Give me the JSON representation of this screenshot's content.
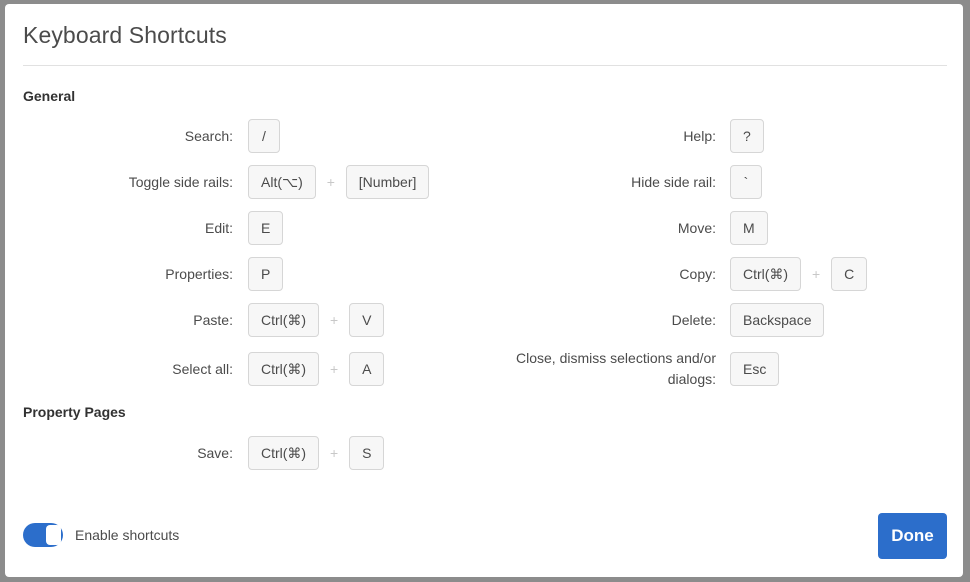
{
  "dialog": {
    "title": "Keyboard Shortcuts",
    "done_label": "Done",
    "toggle_label": "Enable shortcuts",
    "toggle_on": true
  },
  "sections": {
    "general": "General",
    "property_pages": "Property Pages"
  },
  "plus": "+",
  "left": [
    {
      "label": "Search:",
      "keys": [
        "/"
      ]
    },
    {
      "label": "Toggle side rails:",
      "keys": [
        "Alt(⌥)",
        "[Number]"
      ]
    },
    {
      "label": "Edit:",
      "keys": [
        "E"
      ]
    },
    {
      "label": "Properties:",
      "keys": [
        "P"
      ]
    },
    {
      "label": "Paste:",
      "keys": [
        "Ctrl(⌘)",
        "V"
      ]
    },
    {
      "label": "Select all:",
      "keys": [
        "Ctrl(⌘)",
        "A"
      ]
    }
  ],
  "right": [
    {
      "label": "Help:",
      "keys": [
        "?"
      ]
    },
    {
      "label": "Hide side rail:",
      "keys": [
        "`"
      ]
    },
    {
      "label": "Move:",
      "keys": [
        "M"
      ]
    },
    {
      "label": "Copy:",
      "keys": [
        "Ctrl(⌘)",
        "C"
      ]
    },
    {
      "label": "Delete:",
      "keys": [
        "Backspace"
      ]
    },
    {
      "label": "Close, dismiss selections and/or dialogs:",
      "keys": [
        "Esc"
      ]
    }
  ],
  "property_pages": [
    {
      "label": "Save:",
      "keys": [
        "Ctrl(⌘)",
        "S"
      ]
    }
  ]
}
